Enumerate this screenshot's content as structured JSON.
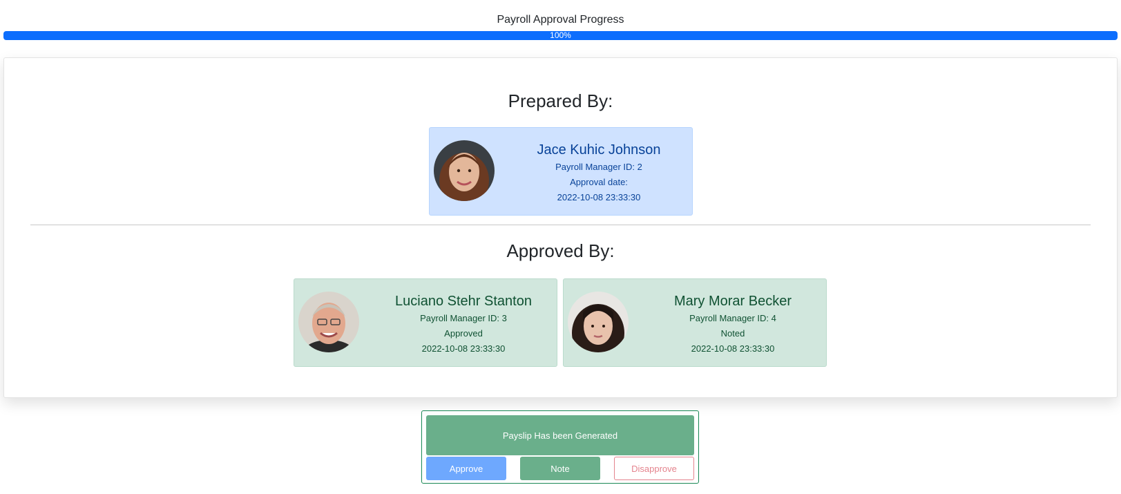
{
  "progress": {
    "title": "Payroll Approval Progress",
    "percent_label": "100%",
    "value": 1.0,
    "color": "#0d6efd"
  },
  "prepared": {
    "heading": "Prepared By:",
    "person": {
      "name": "Jace Kuhic Johnson",
      "id_line": "Payroll Manager ID: 2",
      "status": "Approval date:",
      "date": "2022-10-08 23:33:30"
    }
  },
  "approved": {
    "heading": "Approved By:",
    "people": [
      {
        "name": "Luciano Stehr Stanton",
        "id_line": "Payroll Manager ID: 3",
        "status": "Approved",
        "date": "2022-10-08 23:33:30"
      },
      {
        "name": "Mary Morar Becker",
        "id_line": "Payroll Manager ID: 4",
        "status": "Noted",
        "date": "2022-10-08 23:33:30"
      }
    ]
  },
  "actions": {
    "status_text": "Payslip Has been Generated",
    "approve_label": "Approve",
    "note_label": "Note",
    "disapprove_label": "Disapprove"
  },
  "colors": {
    "prepared_card": "#cfe2ff",
    "approved_card": "#d1e7dd",
    "approve_button": "#6ea8fe",
    "note_button": "#6aaf8b",
    "disapprove_outline": "#e4838d"
  }
}
